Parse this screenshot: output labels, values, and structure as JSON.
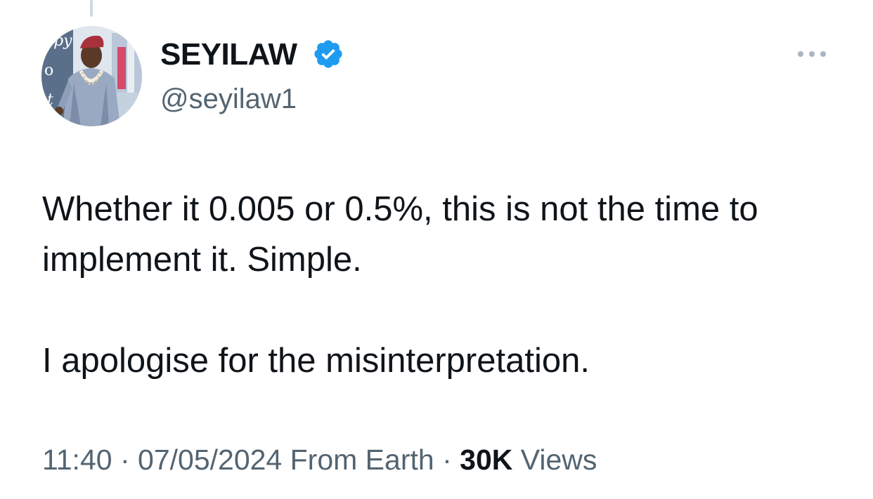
{
  "tweet": {
    "author": {
      "display_name": "SEYILAW",
      "handle": "@seyilaw1",
      "verified": true,
      "avatar_text": "ppy"
    },
    "paragraphs": [
      "Whether it 0.005 or 0.5%, this is not the time to implement it. Simple.",
      "I apologise for the misinterpretation."
    ],
    "meta": {
      "time": "11:40",
      "separator": "·",
      "date": "07/05/2024",
      "source": "From Earth",
      "views_count": "30K",
      "views_label": "Views"
    }
  },
  "colors": {
    "verified": "#1d9bf0",
    "text_primary": "#0f1419",
    "text_secondary": "#536471",
    "thread_line": "#cfd9de"
  },
  "icons": {
    "verified": "verified-badge-icon",
    "more": "more-horizontal-icon"
  }
}
